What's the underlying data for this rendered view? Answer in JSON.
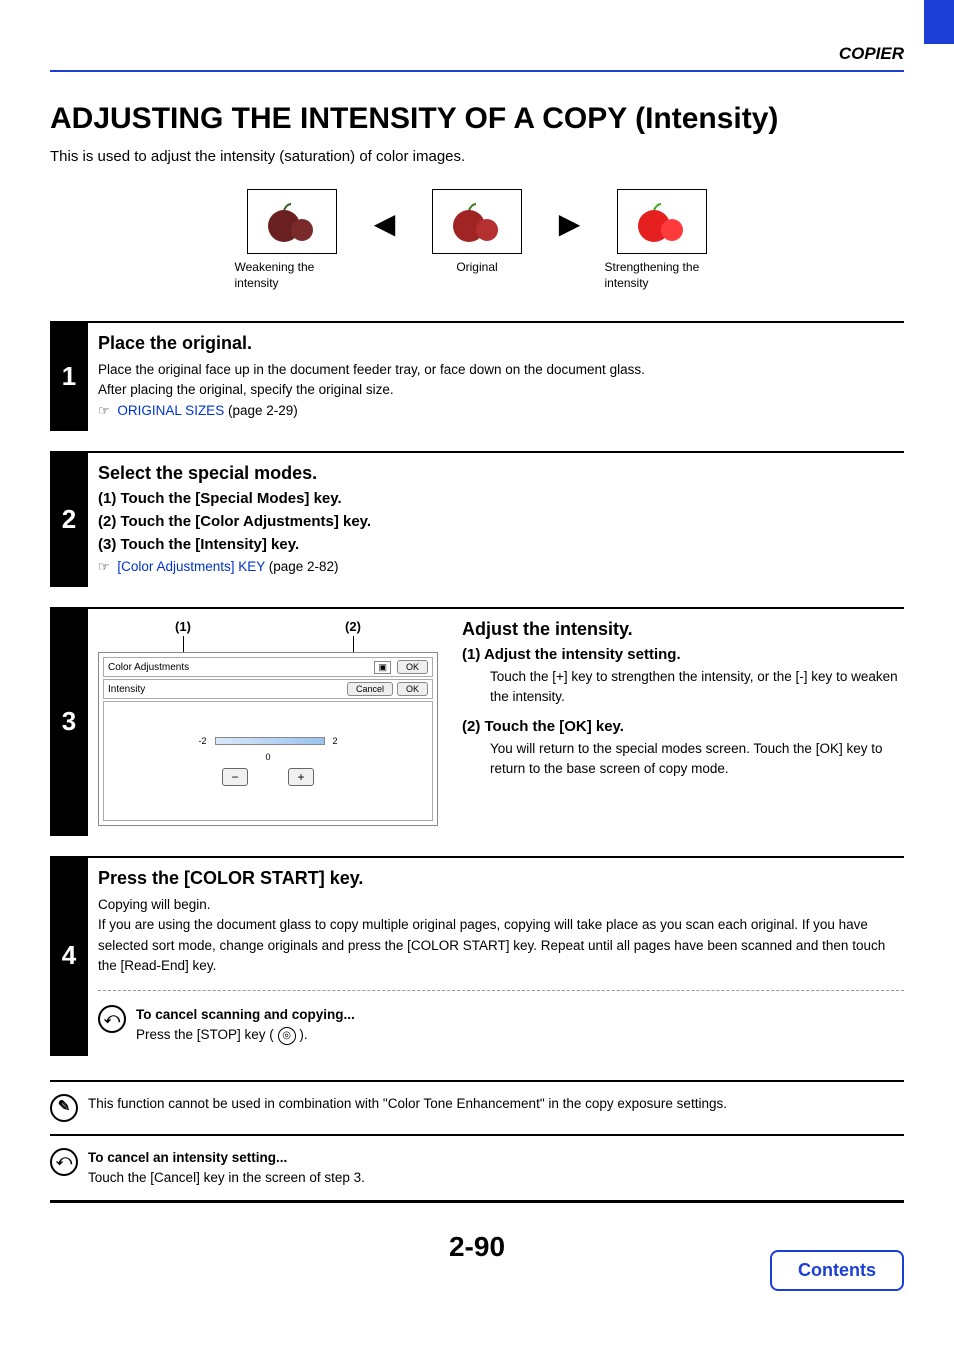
{
  "header": {
    "section": "COPIER"
  },
  "title": "ADJUSTING THE INTENSITY OF A COPY (Intensity)",
  "intro": "This is used to adjust the intensity (saturation) of color images.",
  "illus": {
    "weak": "Weakening the intensity",
    "orig": "Original",
    "strong": "Strengthening the intensity"
  },
  "step1": {
    "num": "1",
    "title": "Place the original.",
    "body1": "Place the original face up in the document feeder tray, or face down on the document glass.",
    "body2": "After placing the original, specify the original size.",
    "link_text": "ORIGINAL SIZES",
    "link_page": " (page 2-29)"
  },
  "step2": {
    "num": "2",
    "title": "Select the special modes.",
    "s1": "(1)   Touch the [Special Modes] key.",
    "s2": "(2)   Touch the [Color Adjustments] key.",
    "s3": "(3)   Touch the [Intensity] key.",
    "link_text": "[Color Adjustments] KEY",
    "link_page": " (page 2-82)"
  },
  "step3": {
    "num": "3",
    "callout1": "(1)",
    "callout2": "(2)",
    "ui": {
      "bar1_label": "Color Adjustments",
      "bar1_ok": "OK",
      "bar2_label": "Intensity",
      "bar2_cancel": "Cancel",
      "bar2_ok": "OK",
      "scale_left": "-2",
      "scale_mid": "0",
      "scale_right": "2",
      "minus": "−",
      "plus": "+"
    },
    "title": "Adjust the intensity.",
    "p1_h": "(1)   Adjust the intensity setting.",
    "p1_b": "Touch the [+] key to strengthen the intensity, or the [-] key to weaken the intensity.",
    "p2_h": "(2)   Touch the [OK] key.",
    "p2_b": "You will return to the special modes screen. Touch the [OK] key to return to the base screen of copy mode."
  },
  "step4": {
    "num": "4",
    "title": "Press the [COLOR START] key.",
    "b1": "Copying will begin.",
    "b2": "If you are using the document glass to copy multiple original pages, copying will take place as you scan each original. If you have selected sort mode, change originals and press the [COLOR START] key. Repeat until all pages have been scanned and then touch the [Read-End] key.",
    "cancel_h": "To cancel scanning and copying...",
    "cancel_b_pre": "Press the [STOP] key (",
    "cancel_b_post": ")."
  },
  "note1": "This function cannot be used in combination with \"Color Tone Enhancement\" in the copy exposure settings.",
  "note2_h": "To cancel an intensity setting...",
  "note2_b": "Touch the [Cancel] key in the screen of step 3.",
  "page_number": "2-90",
  "contents": "Contents"
}
